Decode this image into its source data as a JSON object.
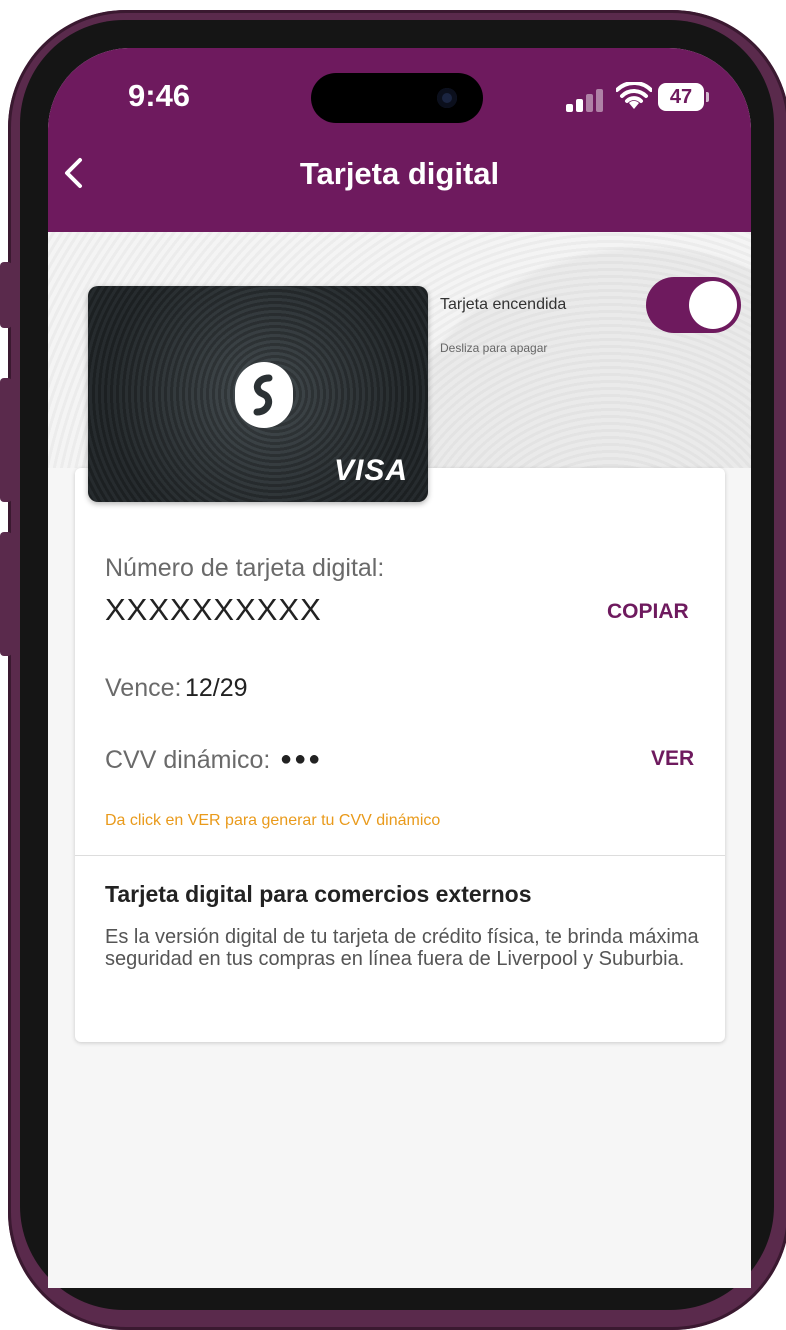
{
  "status_bar": {
    "time": "9:46",
    "battery": "47"
  },
  "header": {
    "title": "Tarjeta digital"
  },
  "card": {
    "brand": "VISA"
  },
  "toggle": {
    "label": "Tarjeta encendida",
    "sublabel": "Desliza para apagar",
    "state": "on"
  },
  "details": {
    "number_label": "Número de tarjeta digital:",
    "number_value": "XXXXXXXXXX",
    "copy_label": "COPIAR",
    "expiry_label": "Vence:",
    "expiry_value": "12/29",
    "cvv_label": "CVV dinámico:",
    "cvv_value": "●●●",
    "view_label": "VER",
    "hint": "Da click en VER para generar tu CVV dinámico"
  },
  "info": {
    "title": "Tarjeta digital para comercios externos",
    "body": "Es la versión digital de tu tarjeta de crédito física, te brinda máxima seguridad en tus compras en línea fuera de Liverpool y Suburbia."
  },
  "colors": {
    "brand": "#6e1a5e",
    "hint": "#e99a1b",
    "frame": "#5a2a4c"
  }
}
